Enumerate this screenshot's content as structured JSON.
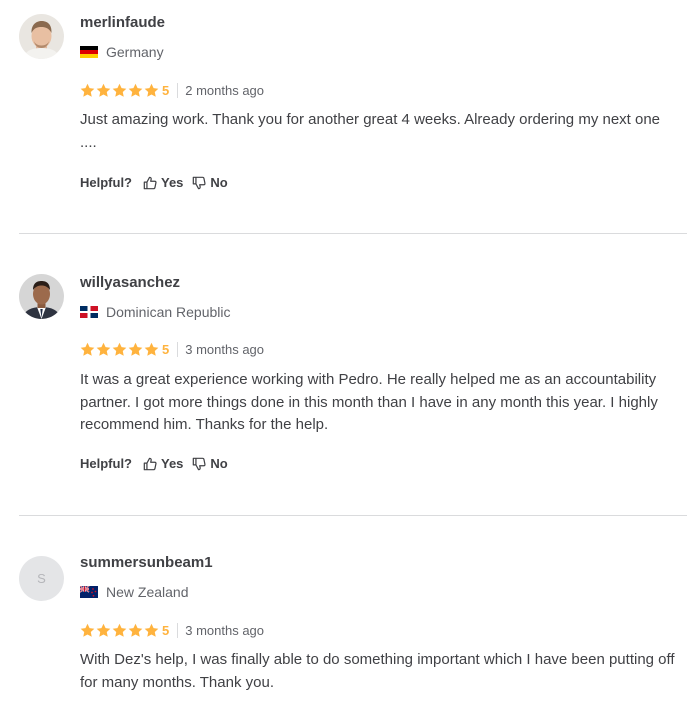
{
  "colors": {
    "star": "#ffb33e",
    "text": "#404145",
    "muted": "#62646a",
    "divider": "#dadbdd"
  },
  "helpful_label": "Helpful?",
  "yes_label": "Yes",
  "no_label": "No",
  "reviews": [
    {
      "username": "merlinfaude",
      "country": "Germany",
      "country_flag": "germany-flag-icon",
      "rating": "5",
      "date": "2 months ago",
      "text": "Just amazing work. Thank you for another great 4 weeks. Already ordering my next one ...."
    },
    {
      "username": "willyasanchez",
      "country": "Dominican Republic",
      "country_flag": "dominican-republic-flag-icon",
      "rating": "5",
      "date": "3 months ago",
      "text": "It was a great experience working with Pedro. He really helped me as an accountability partner. I got more things done in this month than I have in any month this year. I highly recommend him. Thanks for the help."
    },
    {
      "username": "summersunbeam1",
      "avatar_letter": "S",
      "country": "New Zealand",
      "country_flag": "new-zealand-flag-icon",
      "rating": "5",
      "date": "3 months ago",
      "text": "With Dez's help, I was finally able to do something important which I have been putting off for many months. Thank you."
    }
  ]
}
